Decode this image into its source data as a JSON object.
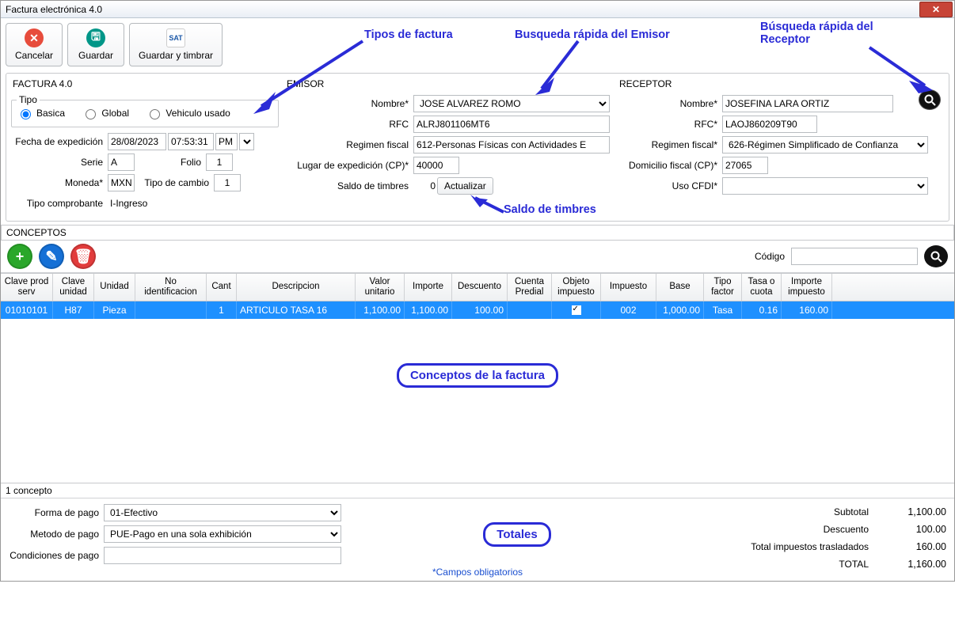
{
  "window": {
    "title": "Factura electrónica 4.0"
  },
  "toolbar": {
    "cancel": "Cancelar",
    "save": "Guardar",
    "save_stamp": "Guardar y timbrar"
  },
  "annotations": {
    "tipos": "Tipos de factura",
    "busq_emisor": "Busqueda rápida del Emisor",
    "busq_receptor": "Búsqueda rápida del Receptor",
    "saldo": "Saldo de timbres",
    "conceptos": "Conceptos de la factura",
    "totales": "Totales"
  },
  "factura": {
    "section": "FACTURA 4.0",
    "tipo_legend": "Tipo",
    "tipo_options": {
      "basica": "Basica",
      "global": "Global",
      "vehiculo": "Vehiculo usado"
    },
    "fecha_label": "Fecha de expedición",
    "fecha": "28/08/2023",
    "hora": "07:53:31",
    "ampm": "PM",
    "serie_label": "Serie",
    "serie": "A",
    "folio_label": "Folio",
    "folio": "1",
    "moneda_label": "Moneda*",
    "moneda": "MXN",
    "tipo_cambio_label": "Tipo de cambio",
    "tipo_cambio": "1",
    "tipo_comp_label": "Tipo comprobante",
    "tipo_comp": "I-Ingreso"
  },
  "emisor": {
    "section": "EMISOR",
    "nombre_label": "Nombre*",
    "nombre": "JOSE ALVAREZ ROMO",
    "rfc_label": "RFC",
    "rfc": "ALRJ801106MT6",
    "regimen_label": "Regimen fiscal",
    "regimen": "612-Personas Físicas con Actividades E",
    "lugar_label": "Lugar de expedición (CP)*",
    "lugar": "40000",
    "saldo_label": "Saldo de timbres",
    "saldo": "0",
    "actualizar": "Actualizar"
  },
  "receptor": {
    "section": "RECEPTOR",
    "nombre_label": "Nombre*",
    "nombre": "JOSEFINA LARA ORTIZ",
    "rfc_label": "RFC*",
    "rfc": "LAOJ860209T90",
    "regimen_label": "Regimen fiscal*",
    "regimen": "626-Régimen Simplificado de Confianza",
    "domicilio_label": "Domicilio fiscal (CP)*",
    "domicilio": "27065",
    "uso_label": "Uso CFDI*",
    "uso": ""
  },
  "conceptos": {
    "title": "CONCEPTOS",
    "codigo_label": "Código",
    "headers": {
      "c1": "Clave prod serv",
      "c2": "Clave unidad",
      "c3": "Unidad",
      "c4": "No identificacion",
      "c5": "Cant",
      "c6": "Descripcion",
      "c7": "Valor unitario",
      "c8": "Importe",
      "c9": "Descuento",
      "c10": "Cuenta Predial",
      "c11": "Objeto impuesto",
      "c12": "Impuesto",
      "c13": "Base",
      "c14": "Tipo factor",
      "c15": "Tasa o cuota",
      "c16": "Importe impuesto"
    },
    "row": {
      "c1": "01010101",
      "c2": "H87",
      "c3": "Pieza",
      "c4": "",
      "c5": "1",
      "c6": "ARTICULO TASA 16",
      "c7": "1,100.00",
      "c8": "1,100.00",
      "c9": "100.00",
      "c10": "",
      "c11": "checked",
      "c12": "002",
      "c13": "1,000.00",
      "c14": "Tasa",
      "c15": "0.16",
      "c16": "160.00"
    },
    "count": "1 concepto"
  },
  "pago": {
    "forma_label": "Forma de pago",
    "forma": "01-Efectivo",
    "metodo_label": "Metodo de pago",
    "metodo": "PUE-Pago en una sola exhibición",
    "cond_label": "Condiciones de pago",
    "cond": ""
  },
  "totales": {
    "subtotal_l": "Subtotal",
    "subtotal": "1,100.00",
    "descuento_l": "Descuento",
    "descuento": "100.00",
    "trasladados_l": "Total impuestos trasladados",
    "trasladados": "160.00",
    "total_l": "TOTAL",
    "total": "1,160.00"
  },
  "campos_obl": "*Campos obligatorios"
}
